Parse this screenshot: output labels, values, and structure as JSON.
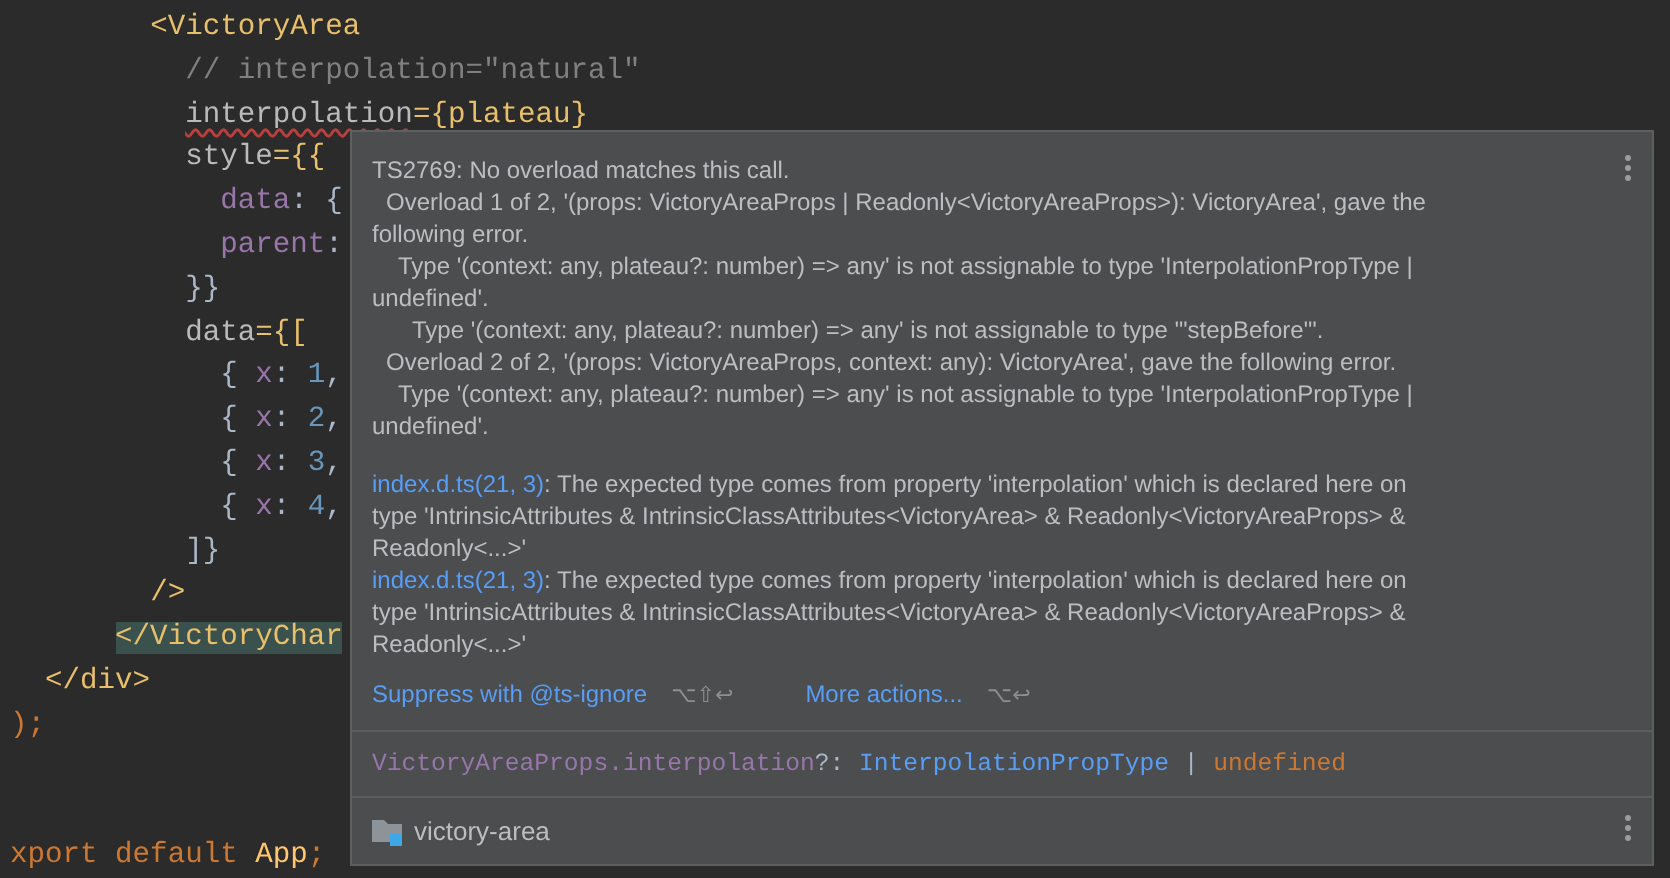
{
  "editor": {
    "lines": [
      {
        "kind": "code",
        "tokens": [
          {
            "kind": "tag",
            "text": "        <VictoryArea"
          }
        ]
      },
      {
        "kind": "code",
        "tokens": [
          {
            "kind": "comment",
            "text": "          // interpolation=\"natural\""
          }
        ]
      },
      {
        "kind": "code",
        "tokens": [
          {
            "kind": "attr-error",
            "text": "          interpolation"
          },
          {
            "kind": "expr",
            "text": "={plateau}"
          }
        ]
      },
      {
        "kind": "code",
        "tokens": [
          {
            "kind": "attr",
            "text": "          style"
          },
          {
            "kind": "expr",
            "text": "={{"
          }
        ]
      },
      {
        "kind": "code",
        "tokens": [
          {
            "kind": "key",
            "text": "            data"
          },
          {
            "kind": "plain",
            "text": ": {"
          }
        ]
      },
      {
        "kind": "code",
        "tokens": [
          {
            "kind": "key",
            "text": "            parent"
          },
          {
            "kind": "plain",
            "text": ":"
          }
        ]
      },
      {
        "kind": "code",
        "tokens": [
          {
            "kind": "plain",
            "text": "          }}"
          }
        ]
      },
      {
        "kind": "code",
        "tokens": [
          {
            "kind": "attr",
            "text": "          data"
          },
          {
            "kind": "expr",
            "text": "={["
          }
        ]
      },
      {
        "kind": "code",
        "tokens": [
          {
            "kind": "plain",
            "text": "            { "
          },
          {
            "kind": "key",
            "text": "x"
          },
          {
            "kind": "plain",
            "text": ": "
          },
          {
            "kind": "number",
            "text": "1"
          },
          {
            "kind": "plain",
            "text": ","
          }
        ]
      },
      {
        "kind": "code",
        "tokens": [
          {
            "kind": "plain",
            "text": "            { "
          },
          {
            "kind": "key",
            "text": "x"
          },
          {
            "kind": "plain",
            "text": ": "
          },
          {
            "kind": "number",
            "text": "2"
          },
          {
            "kind": "plain",
            "text": ","
          }
        ]
      },
      {
        "kind": "code",
        "tokens": [
          {
            "kind": "plain",
            "text": "            { "
          },
          {
            "kind": "key",
            "text": "x"
          },
          {
            "kind": "plain",
            "text": ": "
          },
          {
            "kind": "number",
            "text": "3"
          },
          {
            "kind": "plain",
            "text": ","
          }
        ]
      },
      {
        "kind": "code",
        "tokens": [
          {
            "kind": "plain",
            "text": "            { "
          },
          {
            "kind": "key",
            "text": "x"
          },
          {
            "kind": "plain",
            "text": ": "
          },
          {
            "kind": "number",
            "text": "4"
          },
          {
            "kind": "plain",
            "text": ","
          }
        ]
      },
      {
        "kind": "code",
        "tokens": [
          {
            "kind": "plain",
            "text": "          ]}"
          }
        ]
      },
      {
        "kind": "code",
        "tokens": [
          {
            "kind": "tag",
            "text": "        />"
          }
        ]
      },
      {
        "kind": "code",
        "tokens": [
          {
            "kind": "tag-matched",
            "text": "      </VictoryChar"
          }
        ]
      },
      {
        "kind": "code",
        "tokens": [
          {
            "kind": "tag",
            "text": "  </div>"
          }
        ]
      },
      {
        "kind": "code",
        "tokens": [
          {
            "kind": "keyword",
            "text": ");"
          }
        ]
      },
      {
        "kind": "blank"
      },
      {
        "kind": "blank"
      },
      {
        "kind": "code",
        "tokens": [
          {
            "kind": "keyword",
            "text": "xport default "
          },
          {
            "kind": "ident",
            "text": "App"
          },
          {
            "kind": "keyword",
            "text": ";"
          }
        ]
      }
    ]
  },
  "popup": {
    "message": [
      {
        "kind": "heading",
        "text": "TS2769: No overload matches this call."
      },
      {
        "kind": "overload",
        "text": "Overload 1 of 2, '(props: VictoryAreaProps | Readonly<VictoryAreaProps>): VictoryArea', gave the"
      },
      {
        "kind": "wrap",
        "text": "following error."
      },
      {
        "kind": "type",
        "text": "Type '(context: any, plateau?: number) => any' is not assignable to type 'InterpolationPropType |"
      },
      {
        "kind": "wrap",
        "text": "undefined'."
      },
      {
        "kind": "nested",
        "text": "Type '(context: any, plateau?: number) => any' is not assignable to type '\"stepBefore\"'."
      },
      {
        "kind": "overload",
        "text": "Overload 2 of 2, '(props: VictoryAreaProps, context: any): VictoryArea', gave the following error."
      },
      {
        "kind": "type",
        "text": "Type '(context: any, plateau?: number) => any' is not assignable to type 'InterpolationPropType |"
      },
      {
        "kind": "wrap",
        "text": "undefined'."
      }
    ],
    "related": [
      {
        "link": "index.d.ts(21, 3)",
        "lines": [
          ": The expected type comes from property 'interpolation' which is declared here on",
          "type 'IntrinsicAttributes & IntrinsicClassAttributes<VictoryArea> & Readonly<VictoryAreaProps> &",
          "Readonly<...>'"
        ]
      },
      {
        "link": "index.d.ts(21, 3)",
        "lines": [
          ": The expected type comes from property 'interpolation' which is declared here on",
          "type 'IntrinsicAttributes & IntrinsicClassAttributes<VictoryArea> & Readonly<VictoryAreaProps> &",
          "Readonly<...>'"
        ]
      }
    ],
    "actions": [
      {
        "label": "Suppress with @ts-ignore",
        "shortcut": "⌥⇧↩"
      },
      {
        "label": "More actions...",
        "shortcut": "⌥↩"
      }
    ],
    "signature": [
      {
        "kind": "member",
        "text": "VictoryAreaProps.interpolation"
      },
      {
        "kind": "punct",
        "text": "?: "
      },
      {
        "kind": "type",
        "text": "InterpolationPropType"
      },
      {
        "kind": "punct",
        "text": " | "
      },
      {
        "kind": "keyword",
        "text": "undefined"
      }
    ],
    "footer": {
      "package": "victory-area"
    }
  }
}
